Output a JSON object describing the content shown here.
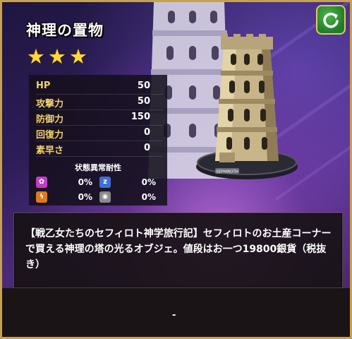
{
  "item": {
    "name": "神理の置物",
    "rarity": 3
  },
  "stats": {
    "rows": [
      {
        "label": "HP",
        "value": "50"
      },
      {
        "label": "攻撃力",
        "value": "50"
      },
      {
        "label": "防御力",
        "value": "150"
      },
      {
        "label": "回復力",
        "value": "0"
      },
      {
        "label": "素早さ",
        "value": "0"
      }
    ],
    "resistance_title": "状態異常耐性",
    "resistances": [
      {
        "icon": "confusion-icon",
        "value": "0%",
        "color": "#c23cc8"
      },
      {
        "icon": "sleep-icon",
        "value": "0%",
        "color": "#3e6fd6"
      },
      {
        "icon": "paralysis-icon",
        "value": "0%",
        "color": "#e0781e"
      },
      {
        "icon": "seal-icon",
        "value": "0%",
        "color": "#8a8a8a"
      }
    ]
  },
  "tower_label": "SEPHIROTH",
  "description": "【戦乙女たちのセフィロト神学旅行記】セフィロトのお土産コーナーで買える神理の塔の光るオブジェ。値段はお一つ19800銀貨（税抜き）",
  "footer": {
    "text": "-"
  },
  "colors": {
    "frame": "#c9a14a",
    "stat_label": "#f3d16a",
    "star": "#ffd93a",
    "refresh": "#2f9a36"
  }
}
